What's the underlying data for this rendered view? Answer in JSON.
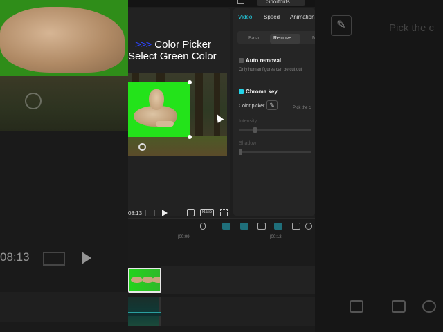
{
  "colors": {
    "accent": "#24d3e8",
    "overlay_arrows": "#2c44ff",
    "green_screen": "#23e31a"
  },
  "background": {
    "time": "08:13",
    "hint_text": "Pick the c"
  },
  "topbar": {
    "shortcuts_label": "Shortcuts"
  },
  "player": {
    "overlay_line1_arrows": ">>>",
    "overlay_line1": "Color Picker",
    "overlay_line2": "Select Green Color",
    "time": "08:13",
    "ratio_label": "Ratio"
  },
  "panel": {
    "tabs": [
      "Video",
      "Speed",
      "Animation"
    ],
    "active_tab": "Video",
    "subtabs": [
      "Basic",
      "Remove ...",
      "M"
    ],
    "active_subtab": "Remove ...",
    "auto_removal": {
      "label": "Auto removal",
      "checked": false,
      "hint": "Only human figures can be cut out"
    },
    "chroma_key": {
      "label": "Chroma key",
      "checked": true,
      "color_picker_label": "Color picker",
      "picker_hint": "Pick the c",
      "picker_icon": "eyedropper-icon"
    },
    "intensity": {
      "label": "Intensity",
      "value": 0.2
    },
    "shadow": {
      "label": "Shadow",
      "value": 0.0
    }
  },
  "timeline": {
    "ruler": [
      "|00:09",
      "|00:12"
    ]
  }
}
